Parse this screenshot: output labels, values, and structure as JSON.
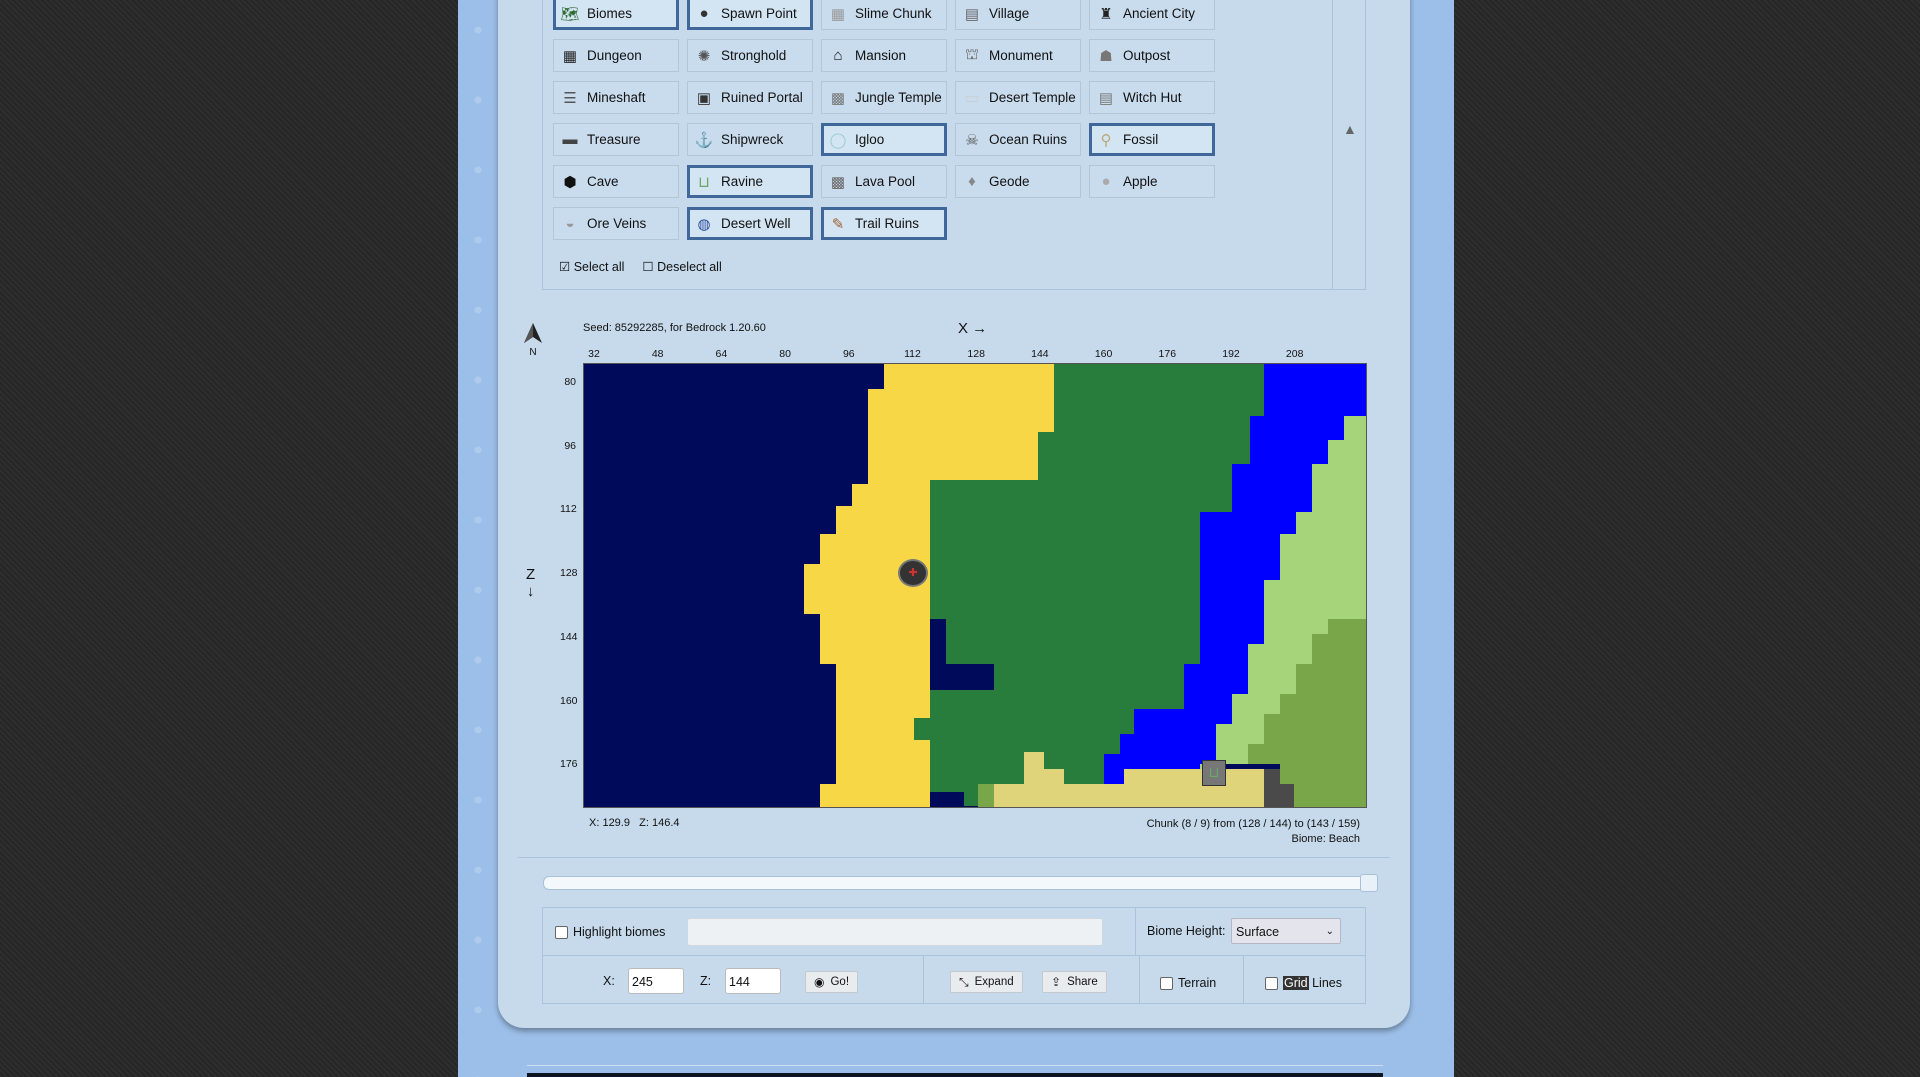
{
  "filters": {
    "items": [
      {
        "label": "Biomes",
        "icon": "biomes-icon",
        "selected": true
      },
      {
        "label": "Spawn Point",
        "icon": "spawn-point-icon",
        "selected": true
      },
      {
        "label": "Slime Chunk",
        "icon": "slime-chunk-icon",
        "selected": false
      },
      {
        "label": "Village",
        "icon": "village-icon",
        "selected": false
      },
      {
        "label": "Ancient City",
        "icon": "ancient-city-icon",
        "selected": false
      },
      {
        "label": "Dungeon",
        "icon": "dungeon-icon",
        "selected": false
      },
      {
        "label": "Stronghold",
        "icon": "stronghold-icon",
        "selected": false
      },
      {
        "label": "Mansion",
        "icon": "mansion-icon",
        "selected": false
      },
      {
        "label": "Monument",
        "icon": "monument-icon",
        "selected": false
      },
      {
        "label": "Outpost",
        "icon": "outpost-icon",
        "selected": false
      },
      {
        "label": "Mineshaft",
        "icon": "mineshaft-icon",
        "selected": false
      },
      {
        "label": "Ruined Portal",
        "icon": "ruined-portal-icon",
        "selected": false
      },
      {
        "label": "Jungle Temple",
        "icon": "jungle-temple-icon",
        "selected": false
      },
      {
        "label": "Desert Temple",
        "icon": "desert-temple-icon",
        "selected": false
      },
      {
        "label": "Witch Hut",
        "icon": "witch-hut-icon",
        "selected": false
      },
      {
        "label": "Treasure",
        "icon": "treasure-icon",
        "selected": false
      },
      {
        "label": "Shipwreck",
        "icon": "anchor-icon",
        "selected": false
      },
      {
        "label": "Igloo",
        "icon": "igloo-icon",
        "selected": true
      },
      {
        "label": "Ocean Ruins",
        "icon": "ocean-ruins-icon",
        "selected": false
      },
      {
        "label": "Fossil",
        "icon": "bone-icon",
        "selected": true
      },
      {
        "label": "Cave",
        "icon": "cave-icon",
        "selected": false
      },
      {
        "label": "Ravine",
        "icon": "ravine-icon",
        "selected": true
      },
      {
        "label": "Lava Pool",
        "icon": "lava-pool-icon",
        "selected": false
      },
      {
        "label": "Geode",
        "icon": "geode-icon",
        "selected": false
      },
      {
        "label": "Apple",
        "icon": "apple-icon",
        "selected": false
      },
      {
        "label": "Ore Veins",
        "icon": "ore-veins-icon",
        "selected": false
      },
      {
        "label": "Desert Well",
        "icon": "desert-well-icon",
        "selected": true
      },
      {
        "label": "Trail Ruins",
        "icon": "brush-icon",
        "selected": true
      }
    ],
    "select_all": "Select all",
    "deselect_all": "Deselect all"
  },
  "map": {
    "seed_text": "Seed: 85292285, for Bedrock 1.20.60",
    "compass_label": "N",
    "x_axis_label": "X →",
    "z_axis_label": "Z",
    "x_ticks": [
      "32",
      "48",
      "64",
      "80",
      "96",
      "112",
      "128",
      "144",
      "160",
      "176",
      "192",
      "208"
    ],
    "z_ticks": [
      "80",
      "96",
      "112",
      "128",
      "144",
      "160",
      "176"
    ],
    "cursor_x": "X: 129.9",
    "cursor_z": "Z: 146.4",
    "chunk_info": "Chunk (8 / 9) from (128 / 144) to (143 / 159)",
    "biome_info": "Biome: Beach",
    "biome_colors": {
      "deep_ocean": "#000a5a",
      "beach": "#f8d746",
      "forest": "#287d3c",
      "river": "#0000ff",
      "plains": "#a6d47a",
      "hills": "#7aa64a",
      "savanna": "#e0d47a",
      "stony": "#4a4a4a"
    }
  },
  "zoom_slider": {
    "value_fraction": 1.0
  },
  "controls": {
    "highlight_biomes": "Highlight biomes",
    "highlight_input_value": "",
    "biome_height_label": "Biome Height:",
    "biome_height_value": "Surface",
    "x_label": "X:",
    "x_value": "245",
    "z_label": "Z:",
    "z_value": "144",
    "go_label": "Go!",
    "expand_label": "Expand",
    "share_label": "Share",
    "terrain_label": "Terrain",
    "grid_label_a": "Grid",
    "grid_label_b": " Lines"
  }
}
